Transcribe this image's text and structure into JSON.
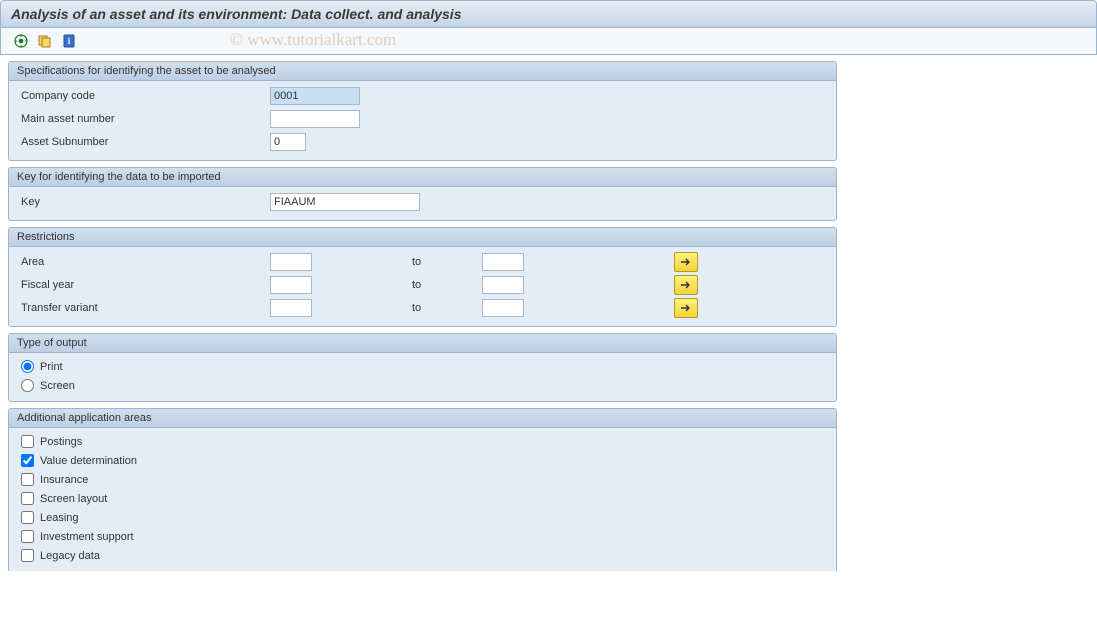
{
  "title": "Analysis of an asset and its environment: Data collect. and analysis",
  "watermark": "© www.tutorialkart.com",
  "toolbar": {
    "execute": "execute",
    "variant": "variant",
    "info": "info"
  },
  "groups": {
    "spec": {
      "title": "Specifications for identifying the asset to be analysed",
      "company_code_label": "Company code",
      "company_code_value": "0001",
      "main_asset_label": "Main asset number",
      "main_asset_value": "",
      "asset_sub_label": "Asset Subnumber",
      "asset_sub_value": "0"
    },
    "key": {
      "title": "Key for identifying the data to be imported",
      "key_label": "Key",
      "key_value": "FIAAUM"
    },
    "restrictions": {
      "title": "Restrictions",
      "area_label": "Area",
      "fiscal_label": "Fiscal year",
      "transfer_label": "Transfer variant",
      "to_label": "to",
      "area_from": "",
      "area_to": "",
      "fiscal_from": "",
      "fiscal_to": "",
      "transfer_from": "",
      "transfer_to": ""
    },
    "output": {
      "title": "Type of output",
      "print_label": "Print",
      "screen_label": "Screen",
      "selected": "print"
    },
    "additional": {
      "title": "Additional application areas",
      "items": [
        {
          "label": "Postings",
          "checked": false
        },
        {
          "label": "Value determination",
          "checked": true
        },
        {
          "label": "Insurance",
          "checked": false
        },
        {
          "label": "Screen layout",
          "checked": false
        },
        {
          "label": "Leasing",
          "checked": false
        },
        {
          "label": "Investment support",
          "checked": false
        },
        {
          "label": "Legacy data",
          "checked": false
        }
      ]
    }
  }
}
